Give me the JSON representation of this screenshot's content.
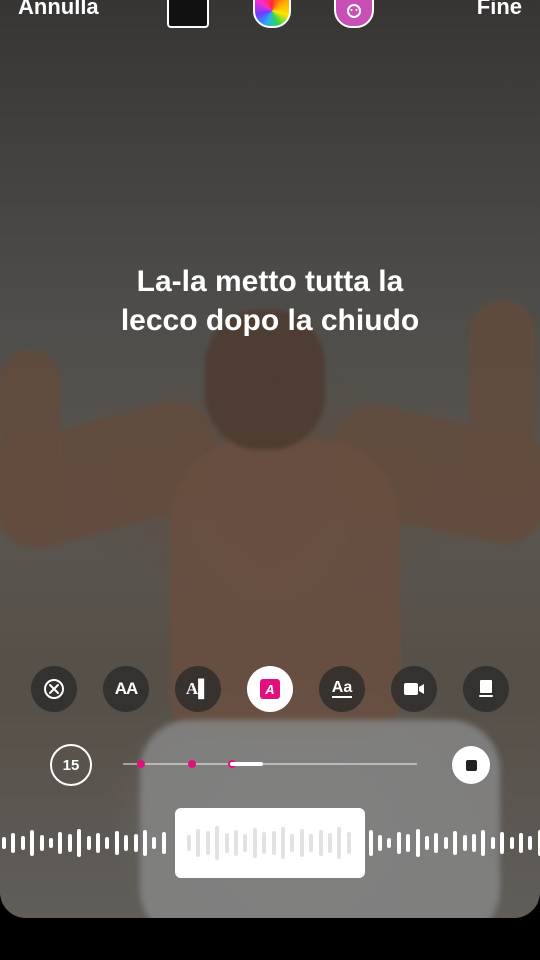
{
  "topbar": {
    "cancel_label": "Annulla",
    "done_label": "Fine",
    "icons": [
      "story-thumbnail",
      "color-wheel-icon",
      "face-sticker-icon"
    ]
  },
  "lyrics": {
    "line1": "La-la metto tutta la",
    "line2": "lecco dopo la chiudo"
  },
  "tools": [
    {
      "name": "close-circle-icon",
      "glyph": "⊗"
    },
    {
      "name": "font-size-icon",
      "glyph": "AA"
    },
    {
      "name": "text-style-icon",
      "glyph": "A▌"
    },
    {
      "name": "highlight-text-icon",
      "glyph": "A"
    },
    {
      "name": "typography-icon",
      "glyph": "Aa"
    },
    {
      "name": "video-camera-icon",
      "glyph": "■"
    },
    {
      "name": "device-icon",
      "glyph": "▮"
    }
  ],
  "timeline": {
    "duration_label": "15",
    "progress_fraction": 0.12,
    "marker_color": "#e2107f"
  },
  "colors": {
    "accent": "#e2107f",
    "white": "#ffffff"
  }
}
